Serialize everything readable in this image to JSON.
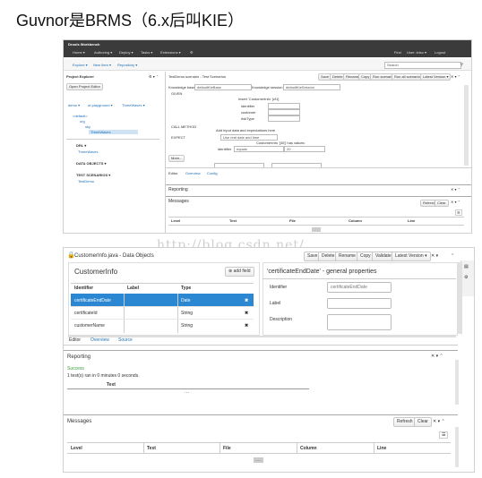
{
  "page_title": "Guvnor是BRMS（6.x后叫KIE）",
  "watermark": "http://blog.csdn.net/",
  "s1": {
    "brand": "Drools Workbench",
    "menu": [
      "Home ▾",
      "Authoring ▾",
      "Deploy ▾",
      "Tasks ▾",
      "Extensions ▾",
      "⚙"
    ],
    "user_menu": [
      "Find",
      "User: krisv ▾",
      "Logout"
    ],
    "subnav": [
      "Explore ▾",
      "New Item ▾",
      "Repository ▾"
    ],
    "search_placeholder": "Search",
    "project_explorer": "Project Explorer",
    "open_project_editor": "Open Project Editor",
    "breadcrumbs": [
      "demo ▾",
      "uf-playground ▾",
      "ThreeWaves ▾"
    ],
    "tree": [
      "<default>",
      "org",
      "sky",
      "ThreeWaves"
    ],
    "drl_label": "DRL ▾",
    "drl_item": "ThreeWaves",
    "data_objects_label": "DATA OBJECTS ▾",
    "test_scenarios_label": "TEST SCENARIOS ▾",
    "test_scenarios_item": "TestDemo",
    "editor_title": "TestDemo.scenario - Test Scenarios",
    "editor_buttons": [
      "Save",
      "Delete",
      "Rename",
      "Copy",
      "Run scenario",
      "Run all scenarios",
      "Latest Version ▾"
    ],
    "kb_label": "Knowledge base",
    "kb_value": "defaultKieBase",
    "ks_label": "Knowledge session",
    "ks_value": "defaultKieSession",
    "given_label": "GIVEN",
    "insert_label": "Insert 'CustomerInfo' [cf1]",
    "fields": [
      "identifier",
      "customer",
      "riskType"
    ],
    "call_method_label": "CALL METHOD",
    "expect_label": "EXPECT",
    "add_expect_hint": "Add input data and expectations here",
    "rule_select": "Use real date and time",
    "customer_info_fact": "CustomerInfo '[45]' has values:",
    "expect_field": "identifier",
    "expect_op": "equals",
    "expect_value": "20",
    "more_button": "More...",
    "tabs": [
      "Editor",
      "Overview",
      "Config"
    ],
    "reporting_title": "Reporting",
    "messages_title": "Messages",
    "msg_buttons": [
      "Refresh",
      "Clear"
    ],
    "columns": [
      "Level",
      "Text",
      "File",
      "Column",
      "Line"
    ]
  },
  "s2": {
    "title": "CustomerInfo.java - Data Objects",
    "buttons": [
      "Save",
      "Delete",
      "Rename",
      "Copy",
      "Validate",
      "Latest Version ▾"
    ],
    "panel_title": "CustomerInfo",
    "add_field": "add field",
    "table_headers": [
      "Identifier",
      "Label",
      "Type"
    ],
    "rows": [
      {
        "id": "certificateEndDate",
        "label": "",
        "type": "Date"
      },
      {
        "id": "certificateId",
        "label": "",
        "type": "String"
      },
      {
        "id": "customerName",
        "label": "",
        "type": "String"
      }
    ],
    "props_title": "'certificateEndDate' - general properties",
    "props": [
      {
        "label": "Identifier",
        "value": "certificateEndDate"
      },
      {
        "label": "Label",
        "value": ""
      },
      {
        "label": "Description",
        "value": ""
      }
    ],
    "tabs": [
      "Editor",
      "Overview",
      "Source"
    ],
    "reporting_title": "Reporting",
    "success_label": "Success",
    "run_summary": "1 test(s) ran in 0 minutes 0 seconds.",
    "text_header": "Text",
    "messages_title": "Messages",
    "msg_buttons": [
      "Refresh",
      "Clear"
    ],
    "columns": [
      "Level",
      "Text",
      "File",
      "Column",
      "Line"
    ],
    "pager": "....."
  }
}
